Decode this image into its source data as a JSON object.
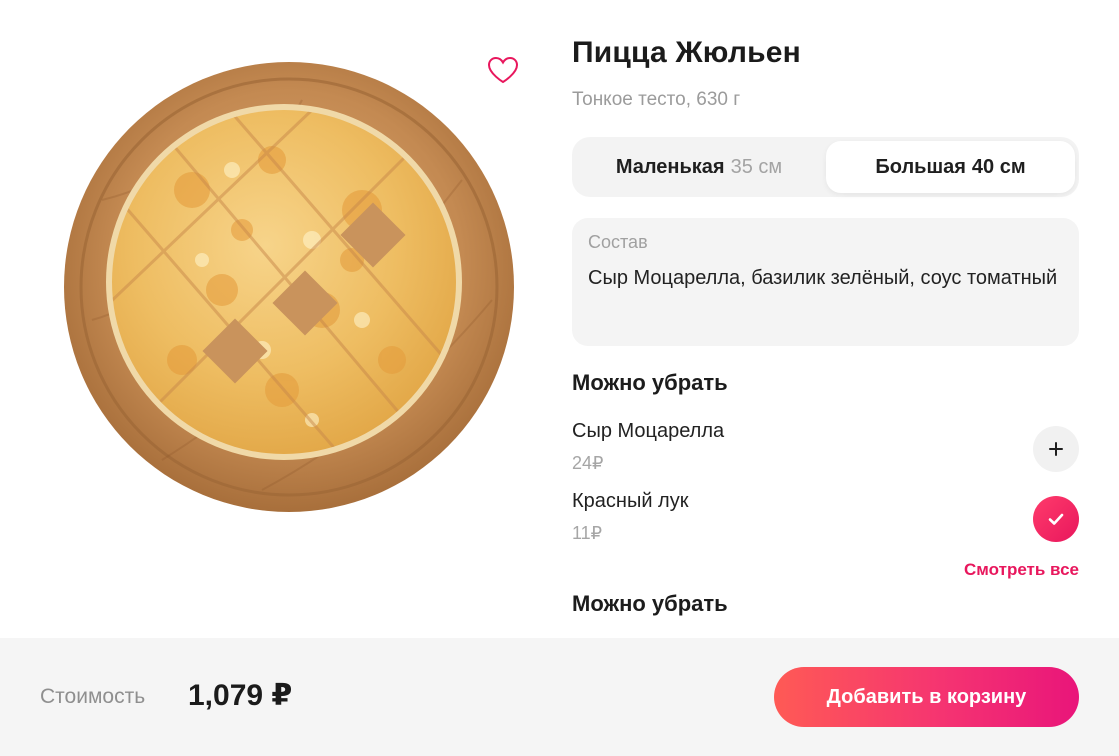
{
  "product": {
    "title": "Пицца Жюльен",
    "subtitle": "Тонкое тесто, 630 г",
    "favorite_icon": "heart-outline-icon",
    "image_icon": "pizza-image"
  },
  "sizes": [
    {
      "label": "Маленькая",
      "dim": "35 см",
      "selected": false
    },
    {
      "label": "Большая",
      "dim": "40 см",
      "selected": true
    }
  ],
  "composition": {
    "label": "Состав",
    "text": "Сыр Моцарелла, базилик зелёный, соус томатный"
  },
  "removable": {
    "title": "Можно убрать",
    "items": [
      {
        "name": "Сыр Моцарелла",
        "price": "24₽",
        "state": "add",
        "icon": "plus-icon"
      },
      {
        "name": "Красный лук",
        "price": "11₽",
        "state": "checked",
        "icon": "check-icon"
      }
    ],
    "see_all": "Смотреть все"
  },
  "removable2": {
    "title": "Можно убрать"
  },
  "footer": {
    "cost_label": "Стоимость",
    "cost_value": "1,079 ₽",
    "add_to_cart": "Добавить в корзину"
  },
  "colors": {
    "accent": "#e8175d",
    "cta_gradient_start": "#ff5a55",
    "cta_gradient_end": "#e9157a",
    "muted": "#9b9b9b"
  }
}
